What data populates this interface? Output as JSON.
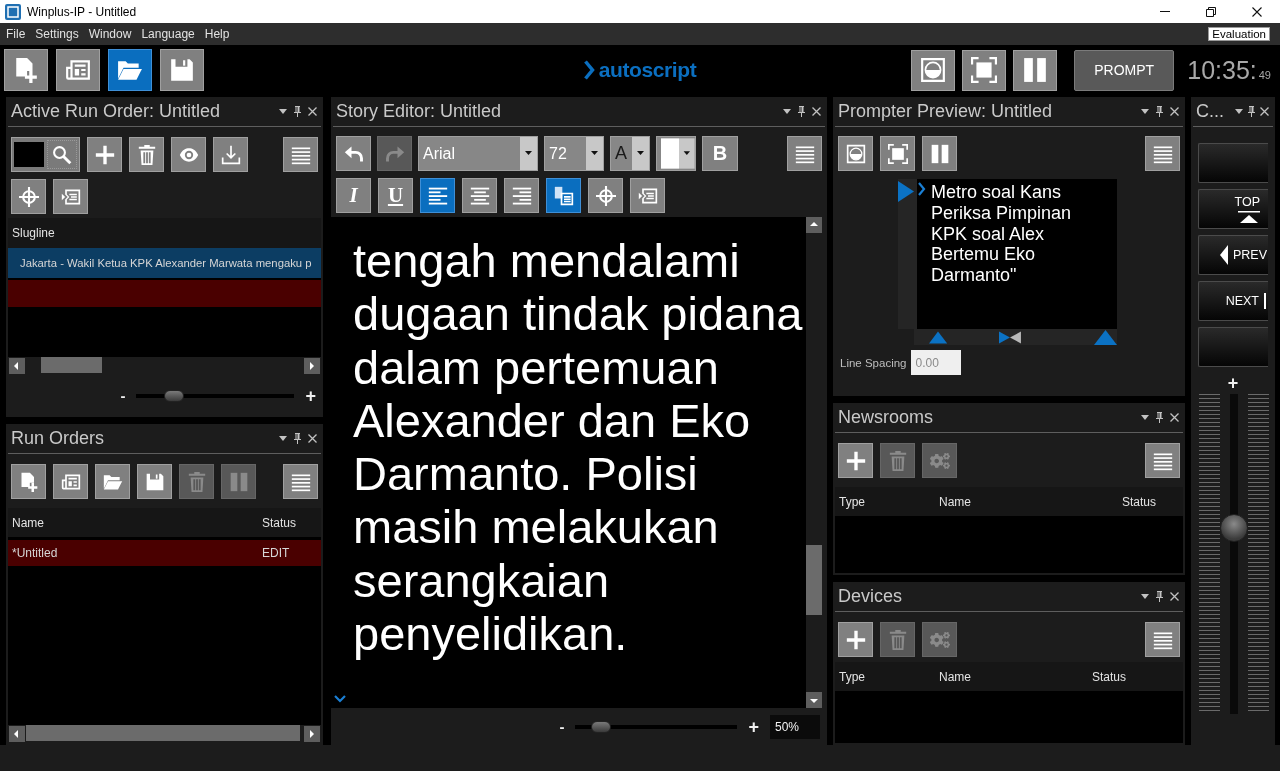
{
  "window": {
    "title": "Winplus-IP - Untitled"
  },
  "menu": [
    "File",
    "Settings",
    "Window",
    "Language",
    "Help"
  ],
  "license": "Evaluation",
  "main_toolbar": {
    "file_buttons": [
      {
        "kind": "new",
        "selected": false
      },
      {
        "kind": "rundown",
        "selected": false
      },
      {
        "kind": "open",
        "selected": true
      },
      {
        "kind": "save",
        "selected": false
      }
    ],
    "logo": "autoscript",
    "output_buttons": [
      {
        "kind": "mirror"
      },
      {
        "kind": "fullscreen"
      },
      {
        "kind": "pause"
      }
    ],
    "prompt_button": "PROMPT",
    "clock": {
      "time": "10:35:",
      "seconds": "49"
    }
  },
  "active_run_order": {
    "title": "Active Run Order: Untitled",
    "toolbar_rows": [
      [
        {
          "kind": "search"
        },
        {
          "kind": "add"
        },
        {
          "kind": "delete"
        },
        {
          "kind": "preview"
        },
        {
          "kind": "import"
        },
        {
          "kind": "menu"
        }
      ],
      [
        {
          "kind": "target"
        },
        {
          "kind": "cue"
        }
      ]
    ],
    "column": "Slugline",
    "rows": [
      {
        "slugline": "Jakarta - Wakil Ketua KPK Alexander Marwata mengaku p",
        "selected": true,
        "loaded": false
      },
      {
        "selected": false,
        "loaded": true
      }
    ],
    "zoom": {
      "min_label": "-",
      "max_label": "+",
      "level": 0.2
    }
  },
  "run_orders": {
    "title": "Run Orders",
    "toolbar": [
      {
        "kind": "new",
        "disabled": false
      },
      {
        "kind": "rundown",
        "disabled": false
      },
      {
        "kind": "open",
        "disabled": false
      },
      {
        "kind": "save",
        "disabled": false
      },
      {
        "kind": "delete",
        "disabled": true
      },
      {
        "kind": "pause",
        "disabled": true
      },
      {
        "kind": "menu",
        "disabled": false
      }
    ],
    "columns": [
      "Name",
      "Status"
    ],
    "rows": [
      {
        "name": "*Untitled",
        "status": "EDIT",
        "loaded": true
      }
    ]
  },
  "story_editor": {
    "title": "Story Editor: Untitled",
    "history": [
      {
        "kind": "undo",
        "disabled": false
      },
      {
        "kind": "redo",
        "disabled": true
      }
    ],
    "font": "Arial",
    "size": "72",
    "text_color": {
      "label": "A"
    },
    "highlight": {
      "color": "#ffffff"
    },
    "styles": [
      {
        "kind": "bold",
        "label": "B"
      },
      {
        "kind": "italic",
        "label": "I"
      },
      {
        "kind": "underline",
        "label": "U"
      }
    ],
    "alignment": [
      {
        "kind": "left",
        "selected": true
      },
      {
        "kind": "center",
        "selected": false
      },
      {
        "kind": "right",
        "selected": false
      }
    ],
    "tools": [
      {
        "kind": "insert",
        "on": true
      },
      {
        "kind": "target",
        "on": false
      },
      {
        "kind": "cue",
        "on": false
      }
    ],
    "script": [
      "tengah mendalami",
      "dugaan tindak pidana",
      "dalam pertemuan",
      "Alexander dan Eko",
      "Darmanto. Polisi",
      "masih melakukan",
      "serangkaian",
      "penyelidikan."
    ],
    "zoom": {
      "min_label": "-",
      "max_label": "+",
      "level": 0.11,
      "reading": "50%"
    }
  },
  "prompter_preview": {
    "title": "Prompter Preview: Untitled",
    "buttons": [
      {
        "kind": "mirror"
      },
      {
        "kind": "fullscreen"
      },
      {
        "kind": "pause"
      },
      {
        "kind": "menu"
      }
    ],
    "lines": [
      "Metro soal Kans",
      "Periksa Pimpinan",
      "KPK soal Alex",
      "Bertemu Eko",
      "Darmanto\""
    ],
    "line_spacing": {
      "label": "Line Spacing",
      "value": "0.00"
    }
  },
  "newsrooms": {
    "title": "Newsrooms",
    "buttons": [
      {
        "kind": "add",
        "disabled": false
      },
      {
        "kind": "delete",
        "disabled": true
      },
      {
        "kind": "settings",
        "disabled": true
      },
      {
        "kind": "menu",
        "disabled": false
      }
    ],
    "columns": [
      "Type",
      "Name",
      "Status"
    ]
  },
  "devices": {
    "title": "Devices",
    "buttons": [
      {
        "kind": "add",
        "disabled": false
      },
      {
        "kind": "delete",
        "disabled": true
      },
      {
        "kind": "settings",
        "disabled": true
      },
      {
        "kind": "menu",
        "disabled": false
      }
    ],
    "columns": [
      "Type",
      "Name",
      "Status"
    ]
  },
  "controller": {
    "title": "C...",
    "buttons": [
      {
        "kind": "blank"
      },
      {
        "kind": "top",
        "label": "TOP"
      },
      {
        "kind": "prev",
        "label": "PREV"
      },
      {
        "kind": "next",
        "label": "NEXT"
      },
      {
        "kind": "blank"
      }
    ],
    "speed": {
      "max_label": "+",
      "level": 0.59
    }
  }
}
